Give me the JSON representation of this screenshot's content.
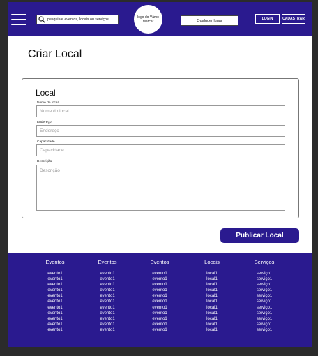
{
  "header": {
    "search_placeholder": "pesquisar eventos, locais ou serviços",
    "logo_text": "logo do Vâmo Marcar",
    "location_label": "Qualquer lugar",
    "login_label": "LOGIN",
    "signup_label": "CADASTRAR"
  },
  "page": {
    "title": "Criar Local"
  },
  "form": {
    "title": "Local",
    "fields": [
      {
        "label": "Nome do local",
        "placeholder": "Nome do local"
      },
      {
        "label": "Endereço",
        "placeholder": "Endereço"
      },
      {
        "label": "Capacidade",
        "placeholder": "Capacidade"
      },
      {
        "label": "Descrição",
        "placeholder": "Descrição"
      }
    ],
    "submit_label": "Publicar Local"
  },
  "footer": {
    "columns": [
      {
        "title": "Eventos",
        "items": [
          "evento1",
          "evento1",
          "evento1",
          "evento1",
          "evento1",
          "evento1",
          "evento1",
          "evento1",
          "evento1",
          "evento1",
          "evento1"
        ]
      },
      {
        "title": "Eventos",
        "items": [
          "evento1",
          "evento1",
          "evento1",
          "evento1",
          "evento1",
          "evento1",
          "evento1",
          "evento1",
          "evento1",
          "evento1",
          "evento1"
        ]
      },
      {
        "title": "Eventos",
        "items": [
          "evento1",
          "evento1",
          "evento1",
          "evento1",
          "evento1",
          "evento1",
          "evento1",
          "evento1",
          "evento1",
          "evento1",
          "evento1"
        ]
      },
      {
        "title": "Locais",
        "items": [
          "local1",
          "local1",
          "local1",
          "local1",
          "local1",
          "local1",
          "local1",
          "local1",
          "local1",
          "local1",
          "local1"
        ]
      },
      {
        "title": "Serviços",
        "items": [
          "serviço1",
          "serviço1",
          "serviço1",
          "serviço1",
          "serviço1",
          "serviço1",
          "serviço1",
          "serviço1",
          "serviço1",
          "serviço1",
          "serviço1"
        ]
      }
    ]
  },
  "colors": {
    "brand": "#2a1a8f",
    "background": "#2b2b2b"
  },
  "icons": {
    "menu": "hamburger-menu-icon",
    "search": "magnifier-search-icon"
  }
}
